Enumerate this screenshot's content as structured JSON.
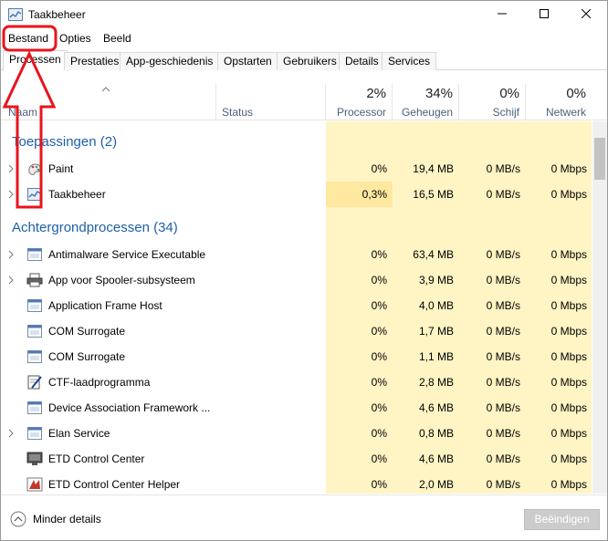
{
  "window": {
    "title": "Taakbeheer",
    "icon": "task-manager-icon"
  },
  "menu": {
    "file": "Bestand",
    "options": "Opties",
    "view": "Beeld"
  },
  "tabs": [
    {
      "label": "Processen",
      "active": true
    },
    {
      "label": "Prestaties"
    },
    {
      "label": "App-geschiedenis"
    },
    {
      "label": "Opstarten"
    },
    {
      "label": "Gebruikers"
    },
    {
      "label": "Details"
    },
    {
      "label": "Services"
    }
  ],
  "columns": {
    "name": "Naam",
    "status": "Status",
    "cpu": {
      "pct": "2%",
      "label": "Processor"
    },
    "memory": {
      "pct": "34%",
      "label": "Geheugen"
    },
    "disk": {
      "pct": "0%",
      "label": "Schijf"
    },
    "network": {
      "pct": "0%",
      "label": "Netwerk"
    }
  },
  "groups": {
    "apps": "Toepassingen (2)",
    "background": "Achtergrondprocessen (34)"
  },
  "apps": [
    {
      "name": "Paint",
      "cpu": "0%",
      "mem": "19,4 MB",
      "disk": "0 MB/s",
      "net": "0 Mbps",
      "expandable": true,
      "icon": "paint-icon"
    },
    {
      "name": "Taakbeheer",
      "cpu": "0,3%",
      "mem": "16,5 MB",
      "disk": "0 MB/s",
      "net": "0 Mbps",
      "expandable": true,
      "icon": "task-manager-icon",
      "highlight": true
    }
  ],
  "background": [
    {
      "name": "Antimalware Service Executable",
      "cpu": "0%",
      "mem": "63,4 MB",
      "disk": "0 MB/s",
      "net": "0 Mbps",
      "expandable": true,
      "icon": "service-window-icon"
    },
    {
      "name": "App voor Spooler-subsysteem",
      "cpu": "0%",
      "mem": "3,9 MB",
      "disk": "0 MB/s",
      "net": "0 Mbps",
      "expandable": true,
      "icon": "printer-icon"
    },
    {
      "name": "Application Frame Host",
      "cpu": "0%",
      "mem": "4,0 MB",
      "disk": "0 MB/s",
      "net": "0 Mbps",
      "expandable": false,
      "icon": "service-window-icon"
    },
    {
      "name": "COM Surrogate",
      "cpu": "0%",
      "mem": "1,7 MB",
      "disk": "0 MB/s",
      "net": "0 Mbps",
      "expandable": false,
      "icon": "service-window-icon"
    },
    {
      "name": "COM Surrogate",
      "cpu": "0%",
      "mem": "1,1 MB",
      "disk": "0 MB/s",
      "net": "0 Mbps",
      "expandable": false,
      "icon": "service-window-icon"
    },
    {
      "name": "CTF-laadprogramma",
      "cpu": "0%",
      "mem": "2,8 MB",
      "disk": "0 MB/s",
      "net": "0 Mbps",
      "expandable": false,
      "icon": "ctf-loader-icon"
    },
    {
      "name": "Device Association Framework ...",
      "cpu": "0%",
      "mem": "4,6 MB",
      "disk": "0 MB/s",
      "net": "0 Mbps",
      "expandable": false,
      "icon": "service-window-icon"
    },
    {
      "name": "Elan Service",
      "cpu": "0%",
      "mem": "0,8 MB",
      "disk": "0 MB/s",
      "net": "0 Mbps",
      "expandable": true,
      "icon": "service-window-icon"
    },
    {
      "name": "ETD Control Center",
      "cpu": "0%",
      "mem": "4,6 MB",
      "disk": "0 MB/s",
      "net": "0 Mbps",
      "expandable": false,
      "icon": "monitor-icon"
    },
    {
      "name": "ETD Control Center Helper",
      "cpu": "0%",
      "mem": "2,0 MB",
      "disk": "0 MB/s",
      "net": "0 Mbps",
      "expandable": false,
      "icon": "etd-helper-icon"
    }
  ],
  "footer": {
    "fewer_details": "Minder details",
    "end_task": "Beëindigen"
  },
  "colors": {
    "accent_blue": "#1f5fa8",
    "column_yellow": "#fff4c4",
    "cpu_highlight": "#ffe9a0",
    "annotation_red": "#e8141c"
  }
}
